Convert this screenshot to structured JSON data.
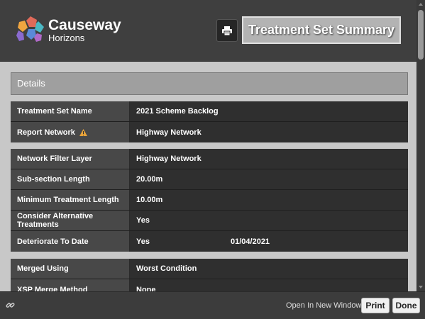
{
  "header": {
    "brand_name": "Causeway",
    "brand_sub": "Horizons",
    "title": "Treatment Set Summary",
    "icons": [
      "causeway-logo",
      "print-icon"
    ]
  },
  "details": {
    "section_title": "Details",
    "group1": [
      {
        "label": "Treatment Set Name",
        "value": "2021 Scheme Backlog"
      },
      {
        "label": "Report Network",
        "value": "Highway Network",
        "icon": "warning-icon"
      }
    ],
    "group2": [
      {
        "label": "Network Filter Layer",
        "value": "Highway Network"
      },
      {
        "label": "Sub-section Length",
        "value": "20.00m"
      },
      {
        "label": "Minimum Treatment Length",
        "value": "10.00m"
      },
      {
        "label": "Consider Alternative Treatments",
        "value": "Yes"
      },
      {
        "label": "Deteriorate To Date",
        "value": "Yes",
        "value2": "01/04/2021"
      }
    ],
    "group3": [
      {
        "label": "Merged Using",
        "value": "Worst Condition"
      },
      {
        "label": "XSP Merge Method",
        "value": "None"
      }
    ]
  },
  "footer": {
    "open_new_window": "Open In New Window",
    "print_label": "Print",
    "done_label": "Done"
  },
  "colors": {
    "header_bg": "#3f3f3f",
    "content_bg": "#c8c8c8",
    "row_bg": "#2f2f2f",
    "label_bg": "#484848",
    "warning": "#e8a33a"
  }
}
